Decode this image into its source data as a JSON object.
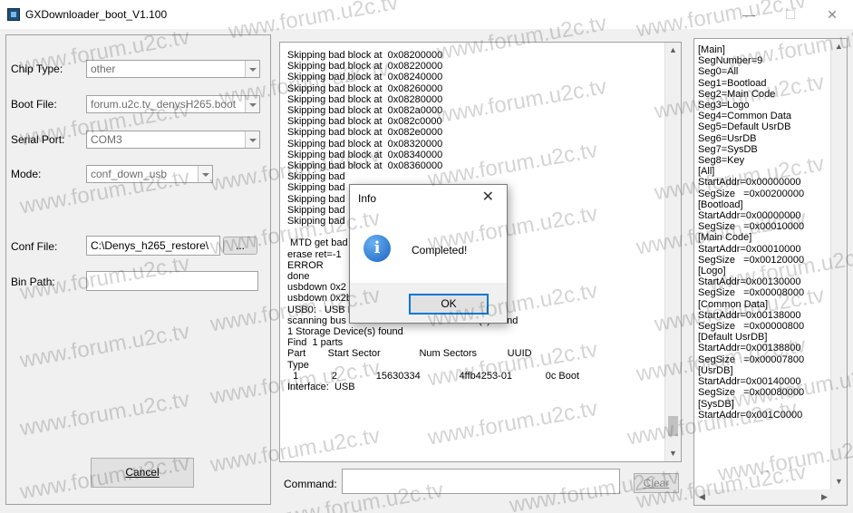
{
  "window": {
    "title": "GXDownloader_boot_V1.100",
    "min_glyph": "—",
    "max_glyph": "☐",
    "close_glyph": "✕"
  },
  "left": {
    "chip_type_label": "Chip Type:",
    "chip_type_value": "other",
    "boot_file_label": "Boot File:",
    "boot_file_value": "forum.u2c.tv_denysH265.boot",
    "serial_port_label": "Serial Port:",
    "serial_port_value": "COM3",
    "mode_label": "Mode:",
    "mode_value": "conf_down_usb",
    "conf_file_label": "Conf File:",
    "conf_file_value": "C:\\Denys_h265_restore\\",
    "browse_label": "...",
    "bin_path_label": "Bin Path:",
    "bin_path_value": "",
    "cancel_label": "Cancel"
  },
  "log": {
    "lines": [
      "Skipping bad block at  0x08200000",
      "Skipping bad block at  0x08220000",
      "Skipping bad block at  0x08240000",
      "Skipping bad block at  0x08260000",
      "Skipping bad block at  0x08280000",
      "Skipping bad block at  0x082a0000",
      "Skipping bad block at  0x082c0000",
      "Skipping bad block at  0x082e0000",
      "Skipping bad block at  0x08320000",
      "Skipping bad block at  0x08340000",
      "Skipping bad block at  0x08360000",
      "Skipping bad",
      "Skipping bad",
      "Skipping bad",
      "Skipping bad",
      "Skipping bad",
      "",
      " MTD get bad",
      "erase ret=-1",
      "ERROR",
      "done",
      "usbdown 0x2",
      "usbdown 0x2b00000 /ubifs.img",
      "USB0:   USB EHCI 1.00",
      "scanning bus 0 for devices... 3 USB Device(s) found",
      "1 Storage Device(s) found",
      "Find  1 parts",
      "Part        Start Sector              Num Sectors           UUID",
      "Type",
      "  1            2              15630334              4ffb4253-01            0c Boot",
      "Interface:  USB"
    ],
    "command_label": "Command:",
    "command_value": "",
    "clear_label": "Clear"
  },
  "config": {
    "lines": [
      "[Main]",
      "SegNumber=9",
      "Seg0=All",
      "Seg1=Bootload",
      "Seg2=Main Code",
      "Seg3=Logo",
      "Seg4=Common Data",
      "Seg5=Default UsrDB",
      "Seg6=UsrDB",
      "Seg7=SysDB",
      "Seg8=Key",
      "[All]",
      "StartAddr=0x00000000",
      "SegSize   =0x00200000",
      "[Bootload]",
      "StartAddr=0x00000000",
      "SegSize   =0x00010000",
      "[Main Code]",
      "StartAddr=0x00010000",
      "SegSize   =0x00120000",
      "[Logo]",
      "StartAddr=0x00130000",
      "SegSize   =0x00008000",
      "[Common Data]",
      "StartAddr=0x00138000",
      "SegSize   =0x00000800",
      "[Default UsrDB]",
      "StartAddr=0x00138800",
      "SegSize   =0x00007800",
      "[UsrDB]",
      "StartAddr=0x00140000",
      "SegSize   =0x00080000",
      "[SysDB]",
      "StartAddr=0x001C0000"
    ]
  },
  "dialog": {
    "title": "Info",
    "close_glyph": "✕",
    "icon_glyph": "i",
    "message": "Completed!",
    "ok_label": "OK"
  },
  "watermark": {
    "text": "www.forum.u2c.tv"
  },
  "scroll_glyphs": {
    "up": "▲",
    "down": "▼",
    "left": "◀",
    "right": "▶"
  }
}
